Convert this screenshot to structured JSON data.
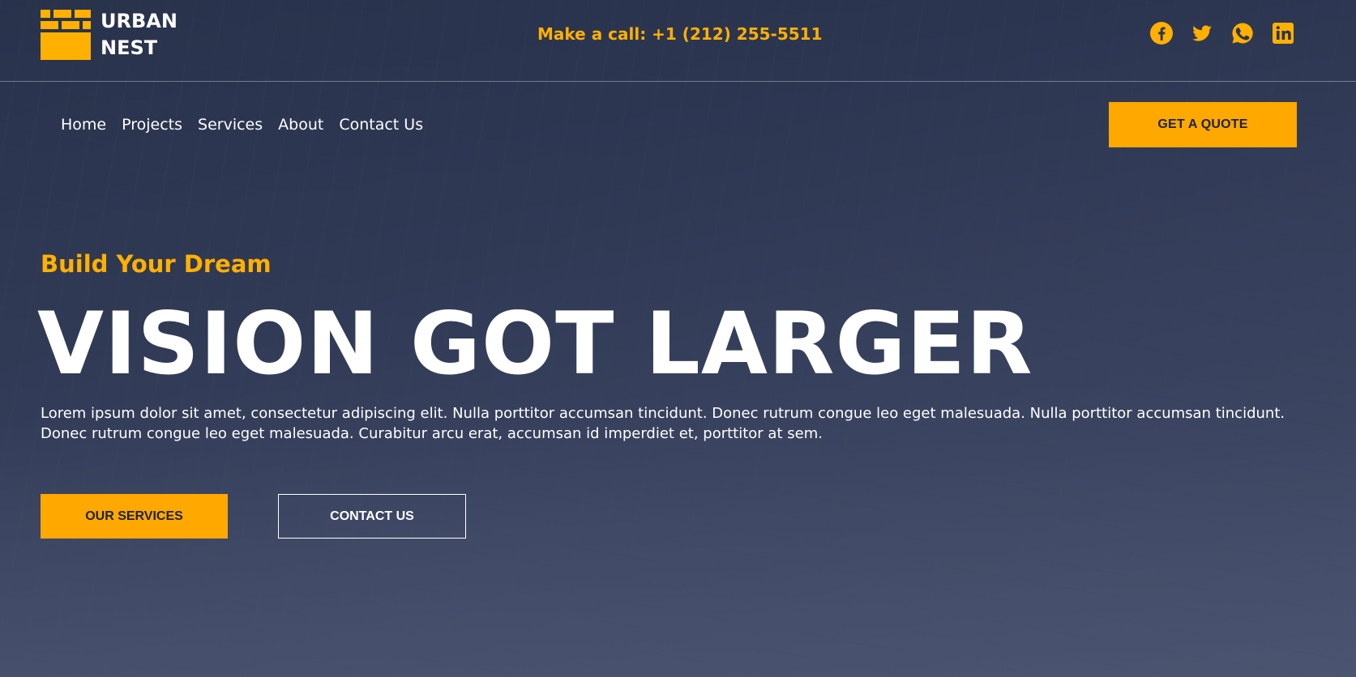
{
  "brand": {
    "line1": "URBAN",
    "line2": "NEST"
  },
  "phone": "Make a call: +1 (212) 255-5511",
  "social": [
    {
      "icon": "facebook-icon"
    },
    {
      "icon": "twitter-icon"
    },
    {
      "icon": "whatsapp-icon"
    },
    {
      "icon": "linkedin-icon"
    }
  ],
  "nav": [
    "Home",
    "Projects",
    "Services",
    "About",
    "Contact Us"
  ],
  "quote_button": "GET A QUOTE",
  "hero": {
    "eyebrow": "Build Your Dream",
    "headline": "VISION GOT LARGER",
    "lead": "Lorem ipsum dolor sit amet, consectetur adipiscing elit. Nulla porttitor accumsan tincidunt. Donec rutrum congue leo eget malesuada. Nulla porttitor accumsan tincidunt. Donec rutrum congue leo eget malesuada. Curabitur arcu erat, accumsan id imperdiet et, porttitor at sem.",
    "primary_button": "OUR SERVICES",
    "secondary_button": "CONTACT US"
  },
  "colors": {
    "accent": "#ffa800",
    "dark": "#1c2235"
  }
}
